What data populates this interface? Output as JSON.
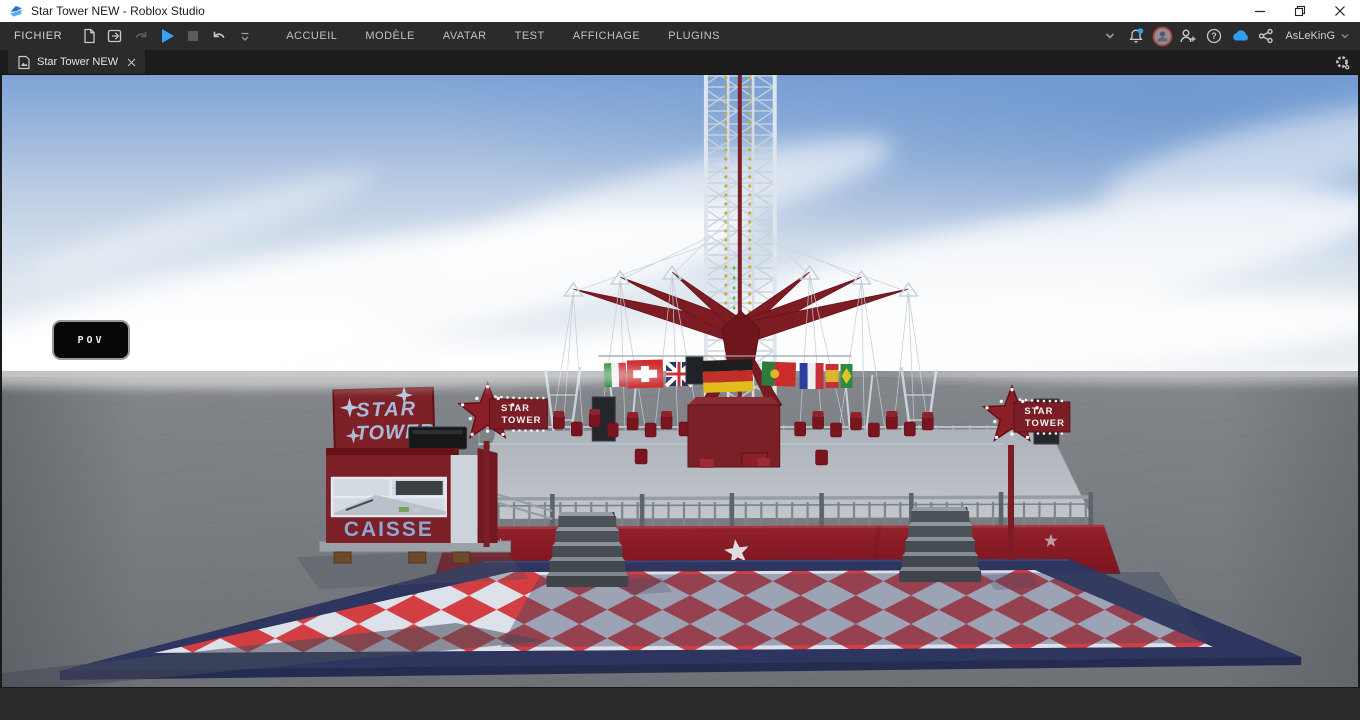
{
  "titlebar": {
    "title": "Star Tower NEW  - Roblox Studio"
  },
  "ribbon": {
    "file_label": "FICHIER",
    "menus": [
      "ACCUEIL",
      "MODÈLE",
      "AVATAR",
      "TEST",
      "AFFICHAGE",
      "PLUGINS"
    ],
    "quick_actions": [
      "new-file",
      "open-file",
      "redo",
      "play",
      "stop",
      "undo",
      "toolbar-options"
    ],
    "right_icons": [
      "collapse-ribbon",
      "notifications",
      "avatar",
      "add-collaborator",
      "help",
      "cloud-sync",
      "share"
    ],
    "help_glyph": "?",
    "username": "AsLeKinG"
  },
  "tabbar": {
    "active_tab_label": "Star Tower NEW"
  },
  "viewport": {
    "pov_button_label": "POV",
    "scene": {
      "booth": {
        "sign_line1": "STAR",
        "sign_line2": "TOWER",
        "window_label": "CAISSE"
      },
      "star_sign_left": {
        "line1": "STAR",
        "line2": "TOWER"
      },
      "star_sign_right": {
        "line1": "STAR",
        "line2": "TOWER"
      },
      "flags": [
        "italy",
        "switzerland",
        "united-kingdom",
        "germany",
        "portugal",
        "france",
        "spain",
        "brazil"
      ],
      "colors": {
        "checker_red": "#da2c2c",
        "checker_white": "#e6e9ef",
        "floor_border_navy": "#2e355f",
        "ride_red": "#7e1c23",
        "sky_blue": "#7da3d6"
      }
    }
  },
  "colors": {
    "play_blue": "#35a4f4",
    "cloud_blue": "#2f9df0",
    "notification_blue": "#2f9df0",
    "avatar_ring": "#b2403c",
    "titlebar_bg": "#ffffff",
    "ribbon_bg": "#2b2b2b",
    "tabbar_bg": "#1c1c1c"
  }
}
